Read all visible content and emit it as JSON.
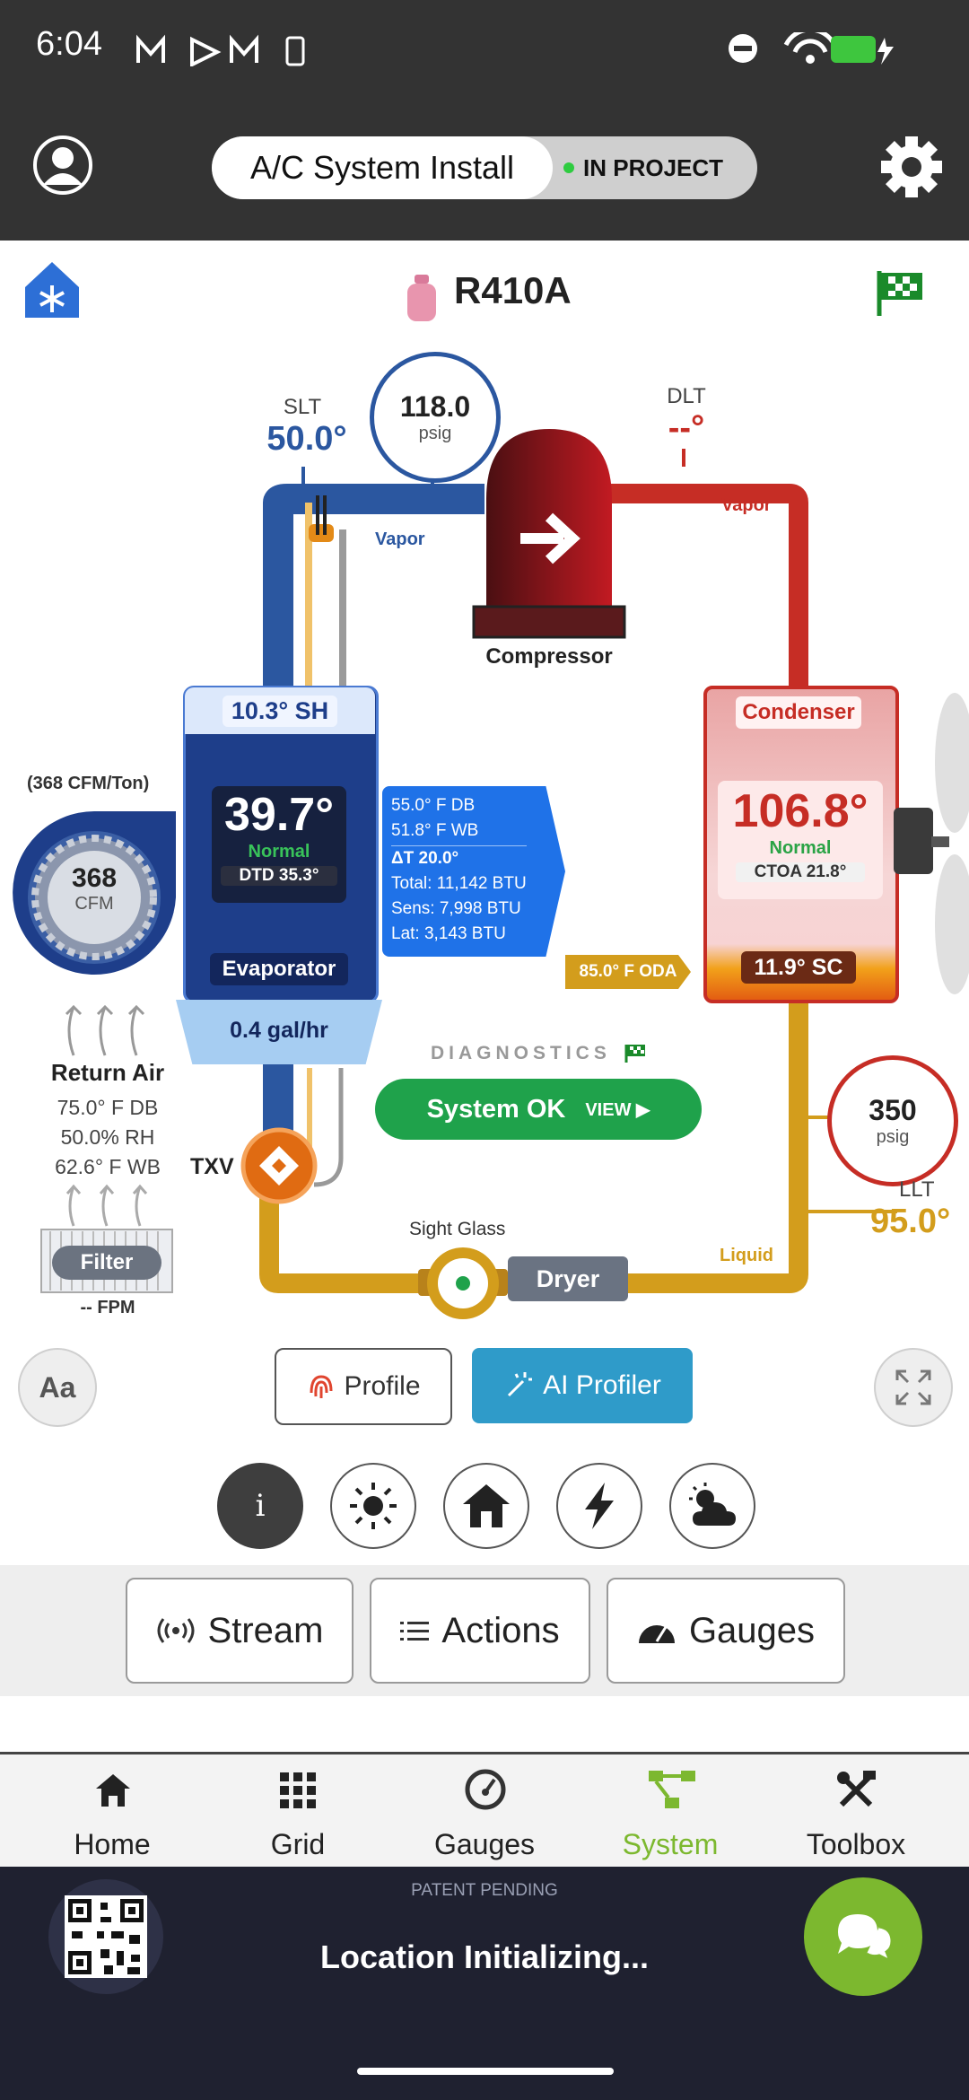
{
  "status_bar": {
    "time": "6:04"
  },
  "header": {
    "title": "A/C System Install",
    "status": "IN PROJECT"
  },
  "refrigerant": "R410A",
  "diagram": {
    "slt": {
      "label": "SLT",
      "value": "50.0°"
    },
    "suction_pressure": {
      "value": "118.0",
      "unit": "psig"
    },
    "dlt": {
      "label": "DLT",
      "value": "--°"
    },
    "vapor_label": "Vapor",
    "compressor_label": "Compressor",
    "evaporator": {
      "sh": "10.3° SH",
      "temp": "39.7°",
      "status": "Normal",
      "dtd": "DTD 35.3°",
      "label": "Evaporator"
    },
    "airflow": {
      "cfm_per_ton": "(368 CFM/Ton)",
      "cfm": "368",
      "cfm_unit": "CFM"
    },
    "supply_air": {
      "db": "55.0° F DB",
      "wb": "51.8° F WB",
      "delta_t": "ΔT 20.0°",
      "total": "Total: 11,142 BTU",
      "sens": "Sens: 7,998 BTU",
      "lat": "Lat: 3,143 BTU"
    },
    "condenser": {
      "label": "Condenser",
      "temp": "106.8°",
      "status": "Normal",
      "ctoa": "CTOA 21.8°",
      "sc": "11.9° SC"
    },
    "oda": "85.0° F ODA",
    "condensate": "0.4 gal/hr",
    "return_air": {
      "label": "Return Air",
      "db": "75.0° F DB",
      "rh": "50.0% RH",
      "wb": "62.6° F WB"
    },
    "filter": {
      "label": "Filter",
      "fpm": "-- FPM"
    },
    "txv": "TXV",
    "diagnostics": {
      "label": "DIAGNOSTICS",
      "button": "System OK",
      "view": "VIEW ▶"
    },
    "liquid_pressure": {
      "value": "350",
      "unit": "psig"
    },
    "llt": {
      "label": "LLT",
      "value": "95.0°"
    },
    "liquid_label": "Liquid",
    "sight_glass": "Sight Glass",
    "dryer": "Dryer"
  },
  "controls": {
    "font_toggle": "Aa",
    "profile": "Profile",
    "ai_profiler": "AI Profiler",
    "info": "i"
  },
  "actions": {
    "stream": "Stream",
    "actions": "Actions",
    "gauges": "Gauges"
  },
  "nav": [
    {
      "label": "Home",
      "icon": "home-icon"
    },
    {
      "label": "Grid",
      "icon": "grid-icon"
    },
    {
      "label": "Gauges",
      "icon": "gauge-icon"
    },
    {
      "label": "System",
      "icon": "system-icon"
    },
    {
      "label": "Toolbox",
      "icon": "toolbox-icon"
    }
  ],
  "footer": {
    "patent": "PATENT PENDING",
    "location": "Location Initializing..."
  },
  "colors": {
    "accent_green": "#7cb82f",
    "blue": "#2b57a0",
    "red": "#c62d25",
    "gold": "#d39d1c"
  }
}
